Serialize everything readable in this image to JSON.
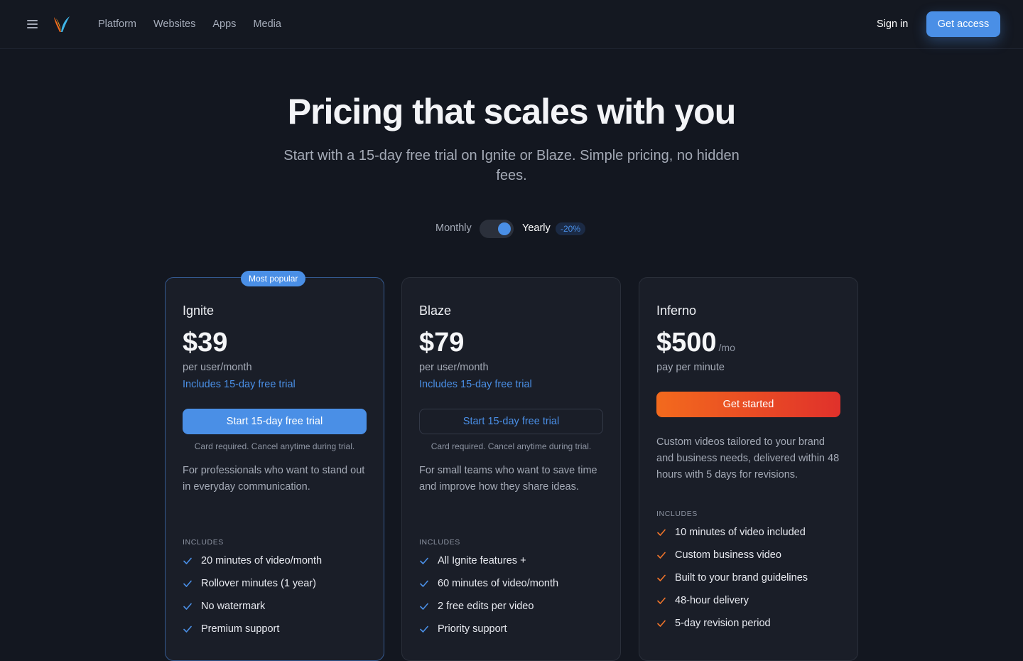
{
  "nav": {
    "items": [
      "Platform",
      "Websites",
      "Apps",
      "Media"
    ],
    "sign_in": "Sign in",
    "get_access": "Get access"
  },
  "hero": {
    "title": "Pricing that scales with you",
    "subtitle": "Start with a 15-day free trial on Ignite or Blaze. Simple pricing, no hidden fees."
  },
  "billing": {
    "monthly": "Monthly",
    "yearly": "Yearly",
    "discount": "-20%",
    "selected": "yearly"
  },
  "plans": [
    {
      "badge": "Most popular",
      "name": "Ignite",
      "price": "$39",
      "price_unit": "",
      "per": "per user/month",
      "trial_note": "Includes 15-day free trial",
      "cta": "Start 15-day free trial",
      "fine_print": "Card required. Cancel anytime during trial.",
      "description": "For professionals who want to stand out in everyday communication.",
      "includes_label": "INCLUDES",
      "features": [
        "20 minutes of video/month",
        "Rollover minutes (1 year)",
        "No watermark",
        "Premium support"
      ]
    },
    {
      "name": "Blaze",
      "price": "$79",
      "price_unit": "",
      "per": "per user/month",
      "trial_note": "Includes 15-day free trial",
      "cta": "Start 15-day free trial",
      "fine_print": "Card required. Cancel anytime during trial.",
      "description": "For small teams who want to save time and improve how they share ideas.",
      "includes_label": "INCLUDES",
      "features": [
        "All Ignite features +",
        "60 minutes of video/month",
        "2 free edits per video",
        "Priority support"
      ]
    },
    {
      "name": "Inferno",
      "price": "$500",
      "price_unit": "/mo",
      "per": "pay per minute",
      "cta": "Get started",
      "description": "Custom videos tailored to your brand and business needs, delivered within 48 hours with 5 days for revisions.",
      "includes_label": "INCLUDES",
      "features": [
        "10 minutes of video included",
        "Custom business video",
        "Built to your brand guidelines",
        "48-hour delivery",
        "5-day revision period"
      ]
    }
  ],
  "colors": {
    "accent": "#4a8fe6",
    "background": "#131720",
    "card": "#1a1e28",
    "fire_start": "#f36a1d",
    "fire_end": "#e0312b",
    "check_blue": "#4a8fe6",
    "check_orange": "#f0742a"
  }
}
